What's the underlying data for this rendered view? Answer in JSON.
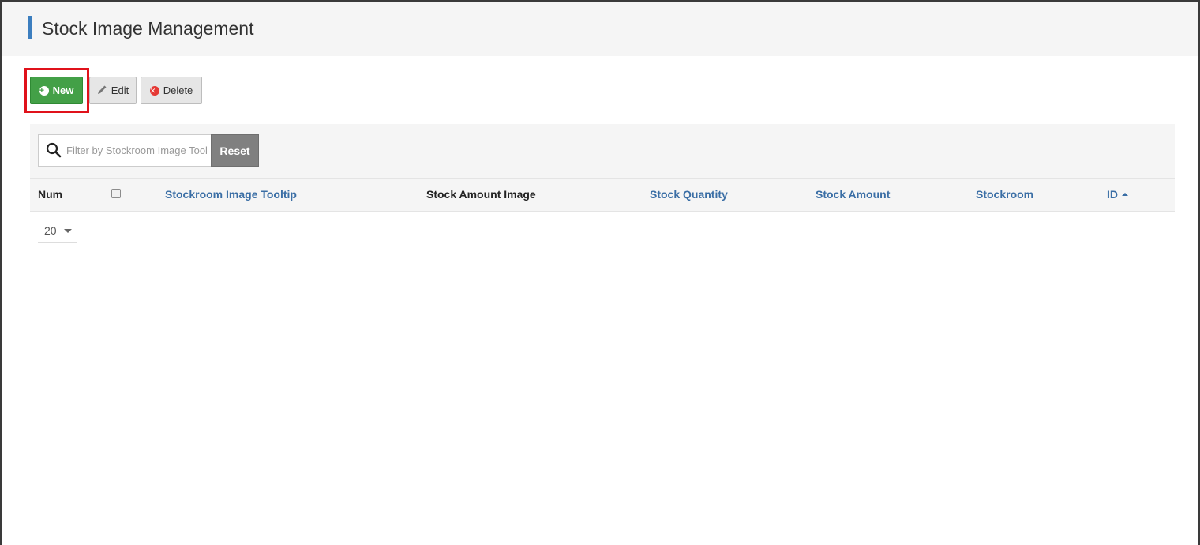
{
  "header": {
    "title": "Stock Image Management"
  },
  "toolbar": {
    "new_label": "New",
    "edit_label": "Edit",
    "delete_label": "Delete"
  },
  "search": {
    "placeholder": "Filter by Stockroom Image Tooltip",
    "value": "",
    "reset_label": "Reset"
  },
  "table": {
    "columns": {
      "num": "Num",
      "stockroom_image_tooltip": "Stockroom Image Tooltip",
      "stock_amount_image": "Stock Amount Image",
      "stock_quantity": "Stock Quantity",
      "stock_amount": "Stock Amount",
      "stockroom": "Stockroom",
      "id": "ID"
    },
    "sort": {
      "column": "ID",
      "direction": "ascending"
    },
    "rows": []
  },
  "pagination": {
    "page_size": "20"
  },
  "colors": {
    "accent": "#3c7ebf",
    "new_button": "#43a047",
    "delete_icon": "#e53935",
    "link": "#3a6ea5",
    "highlight": "#e0121b"
  }
}
